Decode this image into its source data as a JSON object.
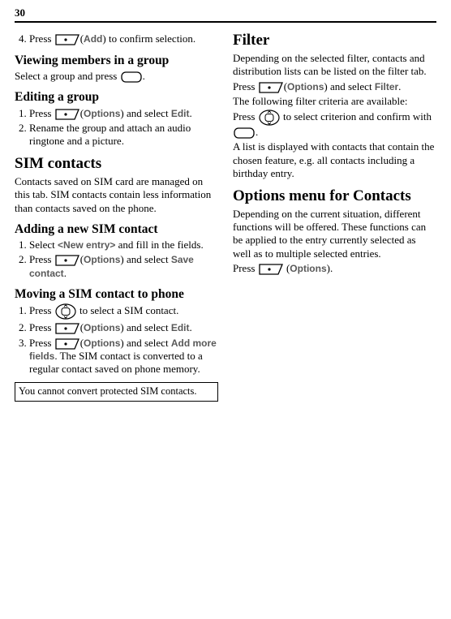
{
  "page_number": "30",
  "col1": {
    "step4": {
      "prefix": "Press ",
      "options_label": "Add",
      "suffix": ") to confirm selection."
    },
    "h3_viewing": "Viewing members in a group",
    "p_viewing_prefix": "Select a group and press ",
    "p_viewing_suffix": ".",
    "h3_editing": "Editing a group",
    "edit_step1_prefix": "Press ",
    "edit_step1_opt": "Options",
    "edit_step1_mid": ") and select ",
    "edit_step1_sel": "Edit",
    "edit_step1_suffix": ".",
    "edit_step2": "Rename the group and attach an audio ringtone and a picture.",
    "h2_sim": "SIM contacts",
    "p_sim": "Contacts saved on SIM card are managed on this tab. SIM contacts contain less information than contacts saved on the phone.",
    "h3_addsim": "Adding a new SIM contact",
    "addsim_step1_prefix": "Select ",
    "addsim_step1_label": "<New entry>",
    "addsim_step1_suffix": " and fill in the fields.",
    "addsim_step2_prefix": "Press ",
    "addsim_step2_opt": "Options",
    "addsim_step2_mid": ") and select ",
    "addsim_step2_sel": "Save contact",
    "addsim_step2_suffix": ".",
    "h3_movesim": "Moving a SIM contact to phone",
    "movesim_step1_prefix": "Press ",
    "movesim_step1_suffix": " to select a SIM contact.",
    "movesim_step2_prefix": "Press ",
    "movesim_step2_opt": "Options",
    "movesim_step2_mid": ") and select ",
    "movesim_step2_sel": "Edit",
    "movesim_step2_suffix": ".",
    "movesim_step3_prefix": "Press ",
    "movesim_step3_opt": "Options",
    "movesim_step3_mid": ") and select ",
    "movesim_step3_sel": "Add more fields",
    "movesim_step3_suffix": ". The SIM contact is converted to a regular contact saved on phone memory.",
    "note": "You cannot convert protected SIM contacts."
  },
  "col2": {
    "h2_filter": "Filter",
    "p_filter1": "Depending on the selected filter, contacts and distribution lists can be listed on the filter tab.",
    "p_filter2_prefix": "Press ",
    "p_filter2_opt": "Options",
    "p_filter2_mid": ") and select ",
    "p_filter2_sel": "Filter",
    "p_filter2_suffix": ".",
    "p_filter3": "The following filter criteria are available:",
    "p_filter4_prefix": "Press ",
    "p_filter4_mid": " to select criterion and confirm with ",
    "p_filter4_suffix": ".",
    "p_filter5": "A list is displayed with contacts that contain the chosen feature, e.g. all contacts including a birthday entry.",
    "h2_optmenu": "Options menu for Contacts",
    "p_optmenu": "Depending on the current situation, different functions will be offered. These functions can be applied to the entry currently selected as well as to multiple selected entries.",
    "p_optmenu2_prefix": "Press ",
    "p_optmenu2_opt": "Options",
    "p_optmenu2_suffix": ")."
  }
}
